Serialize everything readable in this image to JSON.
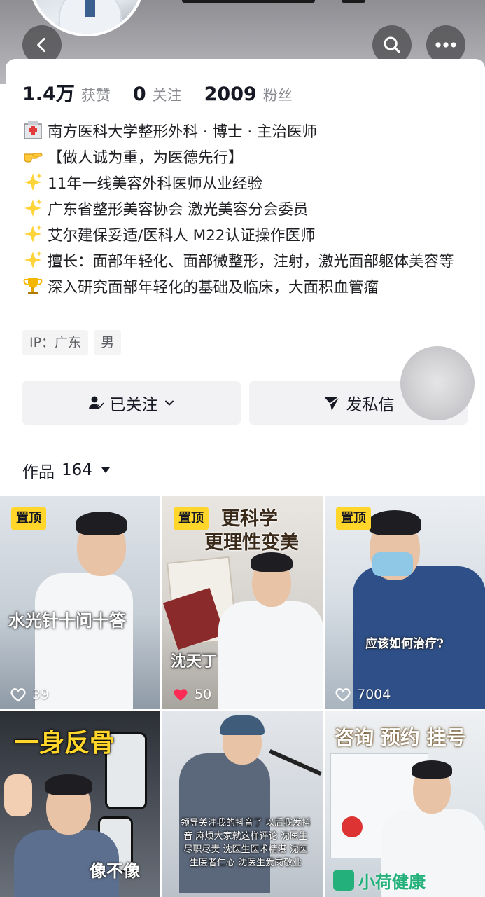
{
  "header": {
    "back_icon": "chevron-left-icon",
    "search_icon": "search-icon",
    "more_icon": "more-horizontal-icon"
  },
  "stats": [
    {
      "value": "1.4万",
      "label": "获赞"
    },
    {
      "value": "0",
      "label": "关注"
    },
    {
      "value": "2009",
      "label": "粉丝"
    }
  ],
  "bio": {
    "line1": "南方医科大学整形外科 · 博士 · 主治医师",
    "line2": "【做人诚为重，为医德先行】",
    "line3": "11年一线美容外科医师从业经验",
    "line4": "广东省整形美容协会 激光美容分会委员",
    "line5": "艾尔建保妥适/医科人 M22认证操作医师",
    "line6": "擅长：面部年轻化、面部微整形，注射，激光面部躯体美容等",
    "line7": "深入研究面部年轻化的基础及临床，大面积血管瘤"
  },
  "tags": {
    "ip": "IP：广东",
    "gender": "男"
  },
  "actions": {
    "follow_label": "已关注",
    "message_label": "发私信"
  },
  "works": {
    "label": "作品",
    "count": "164"
  },
  "videos": [
    {
      "pinned": "置顶",
      "title": "水光针十问十答",
      "likes": "39"
    },
    {
      "pinned": "置顶",
      "title_top": "更科学",
      "title_bottom": "更理性变美",
      "name": "沈天丁",
      "likes": "50"
    },
    {
      "pinned": "置顶",
      "title": "应该如何治疗?",
      "likes": "7004"
    },
    {
      "title": "一身反骨",
      "caption": "像不像"
    },
    {
      "caption": "领导关注我的抖音了 以后我发抖音 麻烦大家就这样评论 沈医生尽职尽责 沈医生医术精湛 沈医生医者仁心 沈医生爱岗敬业"
    },
    {
      "title": "咨询 预约 挂号",
      "brand": "小荷健康"
    }
  ],
  "colors": {
    "pin_bg": "#ffd629",
    "liked_heart": "#fe2c55"
  }
}
